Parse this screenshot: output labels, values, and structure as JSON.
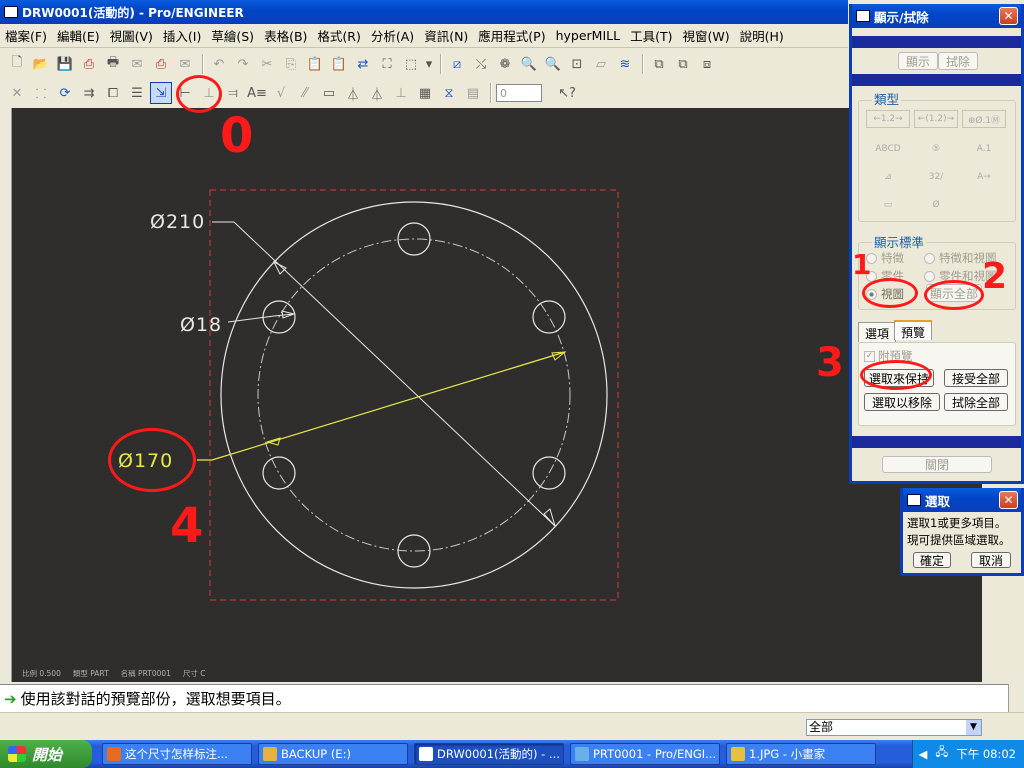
{
  "window": {
    "title": "DRW0001(活動的) - Pro/ENGINEER"
  },
  "menu": [
    "檔案(F)",
    "編輯(E)",
    "視圖(V)",
    "插入(I)",
    "草繪(S)",
    "表格(B)",
    "格式(R)",
    "分析(A)",
    "資訊(N)",
    "應用程式(P)",
    "hyperMILL",
    "工具(T)",
    "視窗(W)",
    "說明(H)"
  ],
  "toolbar2": {
    "spin_value": "0"
  },
  "drawing": {
    "dim_outer": "Ø210",
    "dim_hole": "Ø18",
    "dim_bolt_circle": "Ø170",
    "footer_labels": [
      "比例 0.500",
      "類型 PART",
      "名稱 PRT0001",
      "尺寸 C"
    ]
  },
  "message": {
    "text": "使用該對話的預覽部份，選取想要項目。"
  },
  "status": {
    "filter_value": "全部"
  },
  "show_erase_dialog": {
    "title": "顯示/拭除",
    "tab_show": "顯示",
    "tab_erase": "拭除",
    "type_label": "類型",
    "type_items": [
      "←1.2→",
      "←(1.2)→",
      "⊕Ø.1Ⓜ",
      "ABCD",
      "⑤",
      "A.1",
      "⊿",
      "32/",
      "A→",
      "▭",
      "Ø"
    ],
    "criteria_label": "顯示標準",
    "criteria": [
      "特徵",
      "特徵和視圖",
      "零件",
      "零件和視圖",
      "視圖",
      "顯示全部"
    ],
    "tab_options": "選項",
    "tab_preview": "預覽",
    "with_preview": "附預覽",
    "btn_select_keep": "選取來保持",
    "btn_accept_all": "接受全部",
    "btn_select_remove": "選取以移除",
    "btn_erase_all": "拭除全部",
    "btn_close": "關閉"
  },
  "select_dialog": {
    "title": "選取",
    "line1": "選取1或更多項目。",
    "line2": "現可提供區域選取。",
    "ok": "確定",
    "cancel": "取消"
  },
  "annotations": [
    "0",
    "1",
    "2",
    "3",
    "4"
  ],
  "taskbar": {
    "start": "開始",
    "tasks": [
      "这个尺寸怎样标注...",
      "BACKUP (E:)",
      "DRW0001(活動的) - ...",
      "PRT0001 - Pro/ENGI...",
      "1.JPG - 小畫家"
    ],
    "clock": "下午 08:02"
  },
  "colors": {
    "canvas": "#302e2c",
    "dim_yellow": "#e8e84a",
    "annotation_red": "#ff1a1a",
    "xp_blue": "#0a3db8"
  }
}
